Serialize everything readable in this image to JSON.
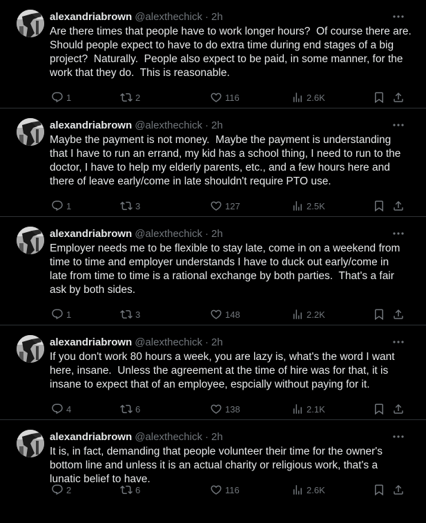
{
  "colors": {
    "background": "#000000",
    "text": "#e7e9ea",
    "muted": "#71767b",
    "divider": "#2f3336"
  },
  "icons": {
    "reply": "reply-icon",
    "retweet": "retweet-icon",
    "like": "like-icon",
    "views": "views-icon",
    "bookmark": "bookmark-icon",
    "share": "share-icon",
    "more": "more-icon"
  },
  "tweets": [
    {
      "name": "alexandriabrown",
      "handle": "@alexthechick",
      "dot": "·",
      "time": "2h",
      "text": "Are there times that people have to work longer hours?  Of course there are.\nShould people expect to have to do extra time during end stages of a big\nproject?  Naturally.  People also expect to be paid, in some manner, for the\nwork that they do.  This is reasonable.",
      "replies": "1",
      "reposts": "2",
      "likes": "116",
      "views": "2.6K"
    },
    {
      "name": "alexandriabrown",
      "handle": "@alexthechick",
      "dot": "·",
      "time": "2h",
      "text": "Maybe the payment is not money.  Maybe the payment is understanding\nthat I have to run an errand, my kid has a school thing, I need to run to the\ndoctor, I have to help my elderly parents, etc., and a few hours here and\nthere of leave early/come in late shouldn't require PTO use.",
      "replies": "1",
      "reposts": "3",
      "likes": "127",
      "views": "2.5K"
    },
    {
      "name": "alexandriabrown",
      "handle": "@alexthechick",
      "dot": "·",
      "time": "2h",
      "text": "Employer needs me to be flexible to stay late, come in on a weekend from\ntime to time and employer understands I have to duck out early/come in\nlate from time to time is a rational exchange by both parties.  That's a fair\nask by both sides.",
      "replies": "1",
      "reposts": "3",
      "likes": "148",
      "views": "2.2K"
    },
    {
      "name": "alexandriabrown",
      "handle": "@alexthechick",
      "dot": "·",
      "time": "2h",
      "text": "If you don't work 80 hours a week, you are lazy is, what's the word I want\nhere, insane.  Unless the agreement at the time of hire was for that, it is\ninsane to expect that of an employee, espcially without paying for it.",
      "replies": "4",
      "reposts": "6",
      "likes": "138",
      "views": "2.1K"
    },
    {
      "name": "alexandriabrown",
      "handle": "@alexthechick",
      "dot": "·",
      "time": "2h",
      "text": "It is, in fact, demanding that people volunteer their time for the owner's\nbottom line and unless it is an actual charity or religious work, that's a\nlunatic belief to have.",
      "replies": "2",
      "reposts": "6",
      "likes": "116",
      "views": "2.6K"
    }
  ]
}
